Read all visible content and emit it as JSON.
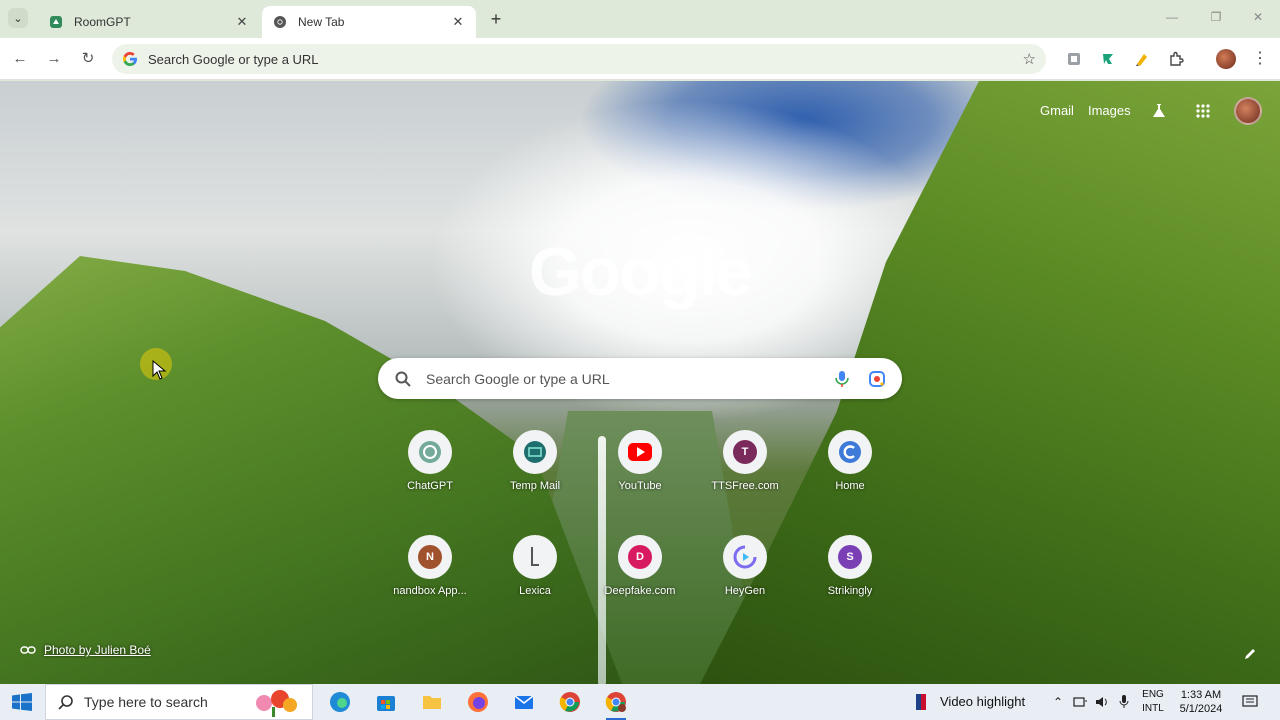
{
  "tabs": [
    {
      "title": "RoomGPT",
      "active": false
    },
    {
      "title": "New Tab",
      "active": true
    }
  ],
  "omnibox": {
    "placeholder": "Search Google or type a URL"
  },
  "ntp": {
    "links": {
      "gmail": "Gmail",
      "images": "Images"
    },
    "logo": "Google",
    "search_placeholder": "Search Google or type a URL",
    "shortcuts": [
      {
        "label": "ChatGPT",
        "initial": "",
        "color": "#74aa9c"
      },
      {
        "label": "Temp Mail",
        "initial": "",
        "color": "#1f6e6e"
      },
      {
        "label": "YouTube",
        "initial": "",
        "color": "#ff0000"
      },
      {
        "label": "TTSFree.com",
        "initial": "T",
        "color": "#7b2a5c"
      },
      {
        "label": "Home",
        "initial": "",
        "color": "#3e7bd9"
      },
      {
        "label": "nandbox App...",
        "initial": "N",
        "color": "#a0522d"
      },
      {
        "label": "Lexica",
        "initial": "",
        "color": "#777777"
      },
      {
        "label": "Deepfake.com",
        "initial": "D",
        "color": "#d81b60"
      },
      {
        "label": "HeyGen",
        "initial": "",
        "color": "#7c6cf0"
      },
      {
        "label": "Strikingly",
        "initial": "S",
        "color": "#7b3fb5"
      }
    ],
    "photo_credit": "Photo by Julien Boé"
  },
  "taskbar": {
    "search_placeholder": "Type here to search",
    "video_highlight": "Video highlight",
    "lang_top": "ENG",
    "lang_bottom": "INTL",
    "time": "1:33 AM",
    "date": "5/1/2024"
  }
}
